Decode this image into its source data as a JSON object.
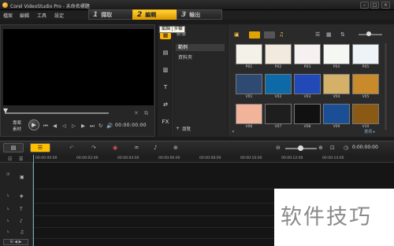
{
  "window": {
    "title": "Corel VideoStudio Pro - 未命名標題",
    "minimize": "–",
    "maximize": "□",
    "close": "×"
  },
  "menu": {
    "items": [
      "檔案",
      "編輯",
      "工具",
      "設定"
    ]
  },
  "steps": [
    {
      "num": "1",
      "label": "擷取"
    },
    {
      "num": "2",
      "label": "編輯"
    },
    {
      "num": "3",
      "label": "輸出"
    }
  ],
  "tooltip": {
    "part1": "編輯",
    "part2": "步驟"
  },
  "preview": {
    "mode_project": "專案",
    "mode_clip": "素材",
    "play": "▶",
    "controls": [
      "⏮",
      "◀",
      "◁",
      "▷",
      "▶",
      "⏭",
      "↻",
      "🔊"
    ],
    "timecode": "00:00:00:00"
  },
  "library": {
    "side_tabs": [
      "▦",
      "▤",
      "▥",
      "T",
      "⇄",
      "FX"
    ],
    "selector": "影像",
    "folders": [
      "範例",
      "資料夾"
    ],
    "browse": "瀏覽",
    "options": "選項 ▸",
    "thumbnails": [
      {
        "label": "P01",
        "color": "#f4f2e8"
      },
      {
        "label": "P02",
        "color": "#f2ebdd"
      },
      {
        "label": "P03",
        "color": "#f7f0f0"
      },
      {
        "label": "P04",
        "color": "#f5f7f2"
      },
      {
        "label": "P05",
        "color": "#eef3f7"
      },
      {
        "label": "V01",
        "color": "#2e4a72"
      },
      {
        "label": "V02",
        "color": "#0e6aa6"
      },
      {
        "label": "V03",
        "color": "#2149b8"
      },
      {
        "label": "V04",
        "color": "#d5b069"
      },
      {
        "label": "V05",
        "color": "#c88a2a"
      },
      {
        "label": "V06",
        "color": "#f1b39a"
      },
      {
        "label": "V07",
        "color": "#1e1e1e"
      },
      {
        "label": "V08",
        "color": "#111111"
      },
      {
        "label": "V09",
        "color": "#1a4f96"
      },
      {
        "label": "V10",
        "color": "#8a5a14"
      }
    ]
  },
  "timeline": {
    "timecode": "0:00:00:00",
    "ticks": [
      "00:00:00:00",
      "00:00:02:00",
      "00:00:04:00",
      "00:00:06:00",
      "00:00:08:00",
      "00:00:10:00",
      "00:00:12:00",
      "00:00:14:00"
    ],
    "tracks": [
      "▣",
      "◈",
      "⊕",
      "T",
      "♪",
      "♫"
    ]
  },
  "watermark": {
    "text": "软件技巧"
  }
}
